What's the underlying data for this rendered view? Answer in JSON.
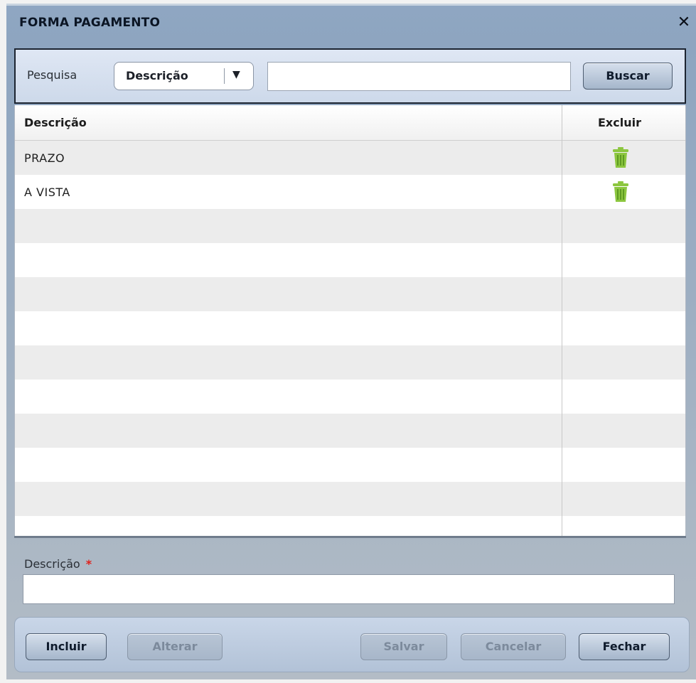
{
  "window": {
    "title": "FORMA PAGAMENTO",
    "close_glyph": "✕",
    "close_icon": "close-icon"
  },
  "search": {
    "label": "Pesquisa",
    "field_selected": "Descrição",
    "dropdown_arrow": "▼",
    "query_value": "",
    "button_label": "Buscar"
  },
  "grid": {
    "columns": [
      "Descrição",
      "Excluir"
    ],
    "rows": [
      {
        "descricao": "PRAZO",
        "delete_icon": "trash-icon"
      },
      {
        "descricao": "A VISTA",
        "delete_icon": "trash-icon"
      }
    ],
    "empty_row_count": 10,
    "stripe_color": "#ececec",
    "trash_color": "#8cc63f"
  },
  "form": {
    "label": "Descrição",
    "required_mark": "*",
    "value": ""
  },
  "footer": {
    "incluir": "Incluir",
    "alterar": "Alterar",
    "salvar": "Salvar",
    "cancelar": "Cancelar",
    "fechar": "Fechar"
  },
  "colors": {
    "window_bg": "#8fa6c2",
    "search_border": "#1c2430",
    "required": "#e0201b"
  }
}
